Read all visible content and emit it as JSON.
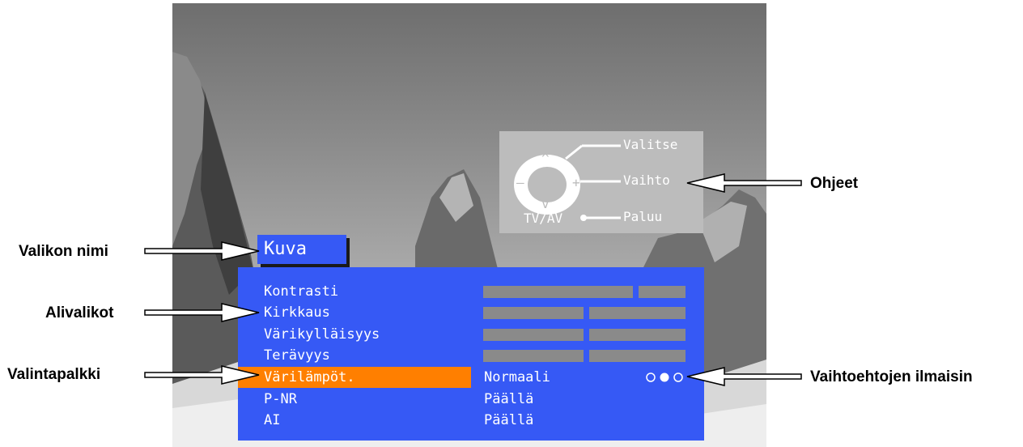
{
  "callouts": {
    "menu_name": "Valikon nimi",
    "submenus": "Alivalikot",
    "selection_bar": "Valintapalkki",
    "instructions": "Ohjeet",
    "option_indicator": "Vaihtoehtojen ilmaisin"
  },
  "menu": {
    "title": "Kuva",
    "selected_index": 4,
    "items": [
      {
        "label": "Kontrasti",
        "value": "",
        "level": 0.78
      },
      {
        "label": "Kirkkaus",
        "value": "",
        "level": 0.5
      },
      {
        "label": "Värikylläisyys",
        "value": "",
        "level": 0.5
      },
      {
        "label": "Terävyys",
        "value": "",
        "level": 0.5
      },
      {
        "label": "Värilämpöt.",
        "value": "Normaali",
        "option_count": 3,
        "option_selected": 2
      },
      {
        "label": "P-NR",
        "value": "Päällä"
      },
      {
        "label": "AI",
        "value": "Päällä"
      }
    ]
  },
  "help": {
    "select": "Valitse",
    "change": "Vaihto",
    "back": "Paluu",
    "tvav": "TV/AV",
    "up_symbol": "^",
    "down_symbol": "v",
    "minus_symbol": "–",
    "plus_symbol": "+"
  },
  "colors": {
    "menu_blue": "#3659f5",
    "selection_orange": "#ff7f00",
    "bar_gray": "#8a8a8a",
    "help_gray": "#bcbcbc"
  }
}
